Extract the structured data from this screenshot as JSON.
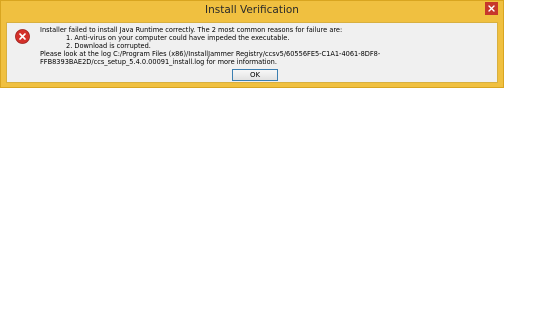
{
  "window": {
    "title": "Install Verification"
  },
  "message": {
    "intro": "Installer failed to install Java Runtime correctly. The 2 most common reasons for failure are:",
    "reasons": [
      "1.  Anti-virus on your computer could have impeded the executable.",
      "2.  Download is corrupted."
    ],
    "log_text": "Please look at the log C:/Program Files (x86)/InstallJammer Registry/ccsv5/60556FE5-C1A1-4061-8DF8-FFB8393BAE2D/ccs_setup_5.4.0.00091_install.log for more information."
  },
  "buttons": {
    "ok_label": "OK"
  },
  "icons": {
    "error": "error-icon",
    "close": "close-icon"
  },
  "colors": {
    "title_bar": "#f0c040",
    "close_button": "#c7372b",
    "error_icon": "#d3302a"
  }
}
